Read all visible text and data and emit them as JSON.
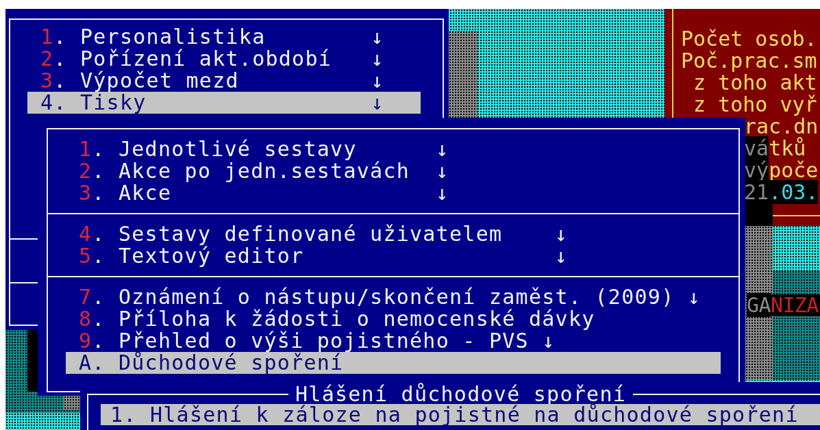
{
  "main_menu": {
    "items": [
      {
        "text": "1. Personalistika",
        "arrow": "↓",
        "selected": false
      },
      {
        "text": "2. Pořízení akt.období",
        "arrow": "↓",
        "selected": false
      },
      {
        "text": "3. Výpočet mezd",
        "arrow": "↓",
        "selected": false
      },
      {
        "text": "4. Tisky",
        "arrow": "↓",
        "selected": true
      }
    ]
  },
  "info_panel": {
    "lines": [
      {
        "kind": "line",
        "text": "Počet osob."
      },
      {
        "kind": "line",
        "text": "Poč.prac.sm"
      },
      {
        "kind": "indented",
        "text": "z toho akt"
      },
      {
        "kind": "indented",
        "text": "z toho vyř"
      },
      {
        "kind": "clipped",
        "text": "rac.dn"
      },
      {
        "kind": "clipped",
        "shaded": "vá",
        "text": "tků"
      },
      {
        "kind": "clipped",
        "shaded": "vý",
        "text": "poče"
      },
      {
        "kind": "date",
        "shaded": "21",
        "text": ".03."
      }
    ]
  },
  "submenu": {
    "groups": [
      {
        "items": [
          {
            "text": "1. Jednotlivé sestavy",
            "arrow": "↓",
            "selected": false
          },
          {
            "text": "2. Akce po jedn.sestavách",
            "arrow": "↓",
            "selected": false
          },
          {
            "text": "3. Akce",
            "arrow": "↓",
            "selected": false
          }
        ]
      },
      {
        "items": [
          {
            "text": "4. Sestavy definované uživatelem",
            "arrow": "↓",
            "selected": false
          },
          {
            "text": "5. Textový editor",
            "arrow": "↓",
            "selected": false
          }
        ]
      },
      {
        "items": [
          {
            "text": "7. Oznámení o nástupu/skončení zaměst. (2009)",
            "arrow": "↓",
            "selected": false
          },
          {
            "text": "8. Příloha k žádosti o nemocenské dávky",
            "selected": false
          },
          {
            "text": "9. Přehled o výši pojistného - PVS",
            "arrow": "↓",
            "selected": false
          },
          {
            "text": "A. Důchodové spoření",
            "selected": true
          }
        ]
      }
    ]
  },
  "side_strip": {
    "shaded": "GA",
    "text": "NIZA"
  },
  "dialog": {
    "title": "Hlášení důchodové spoření",
    "items": [
      {
        "text": "1. Hlášení k záloze na pojistné na důchodové spoření",
        "selected": true
      }
    ]
  }
}
